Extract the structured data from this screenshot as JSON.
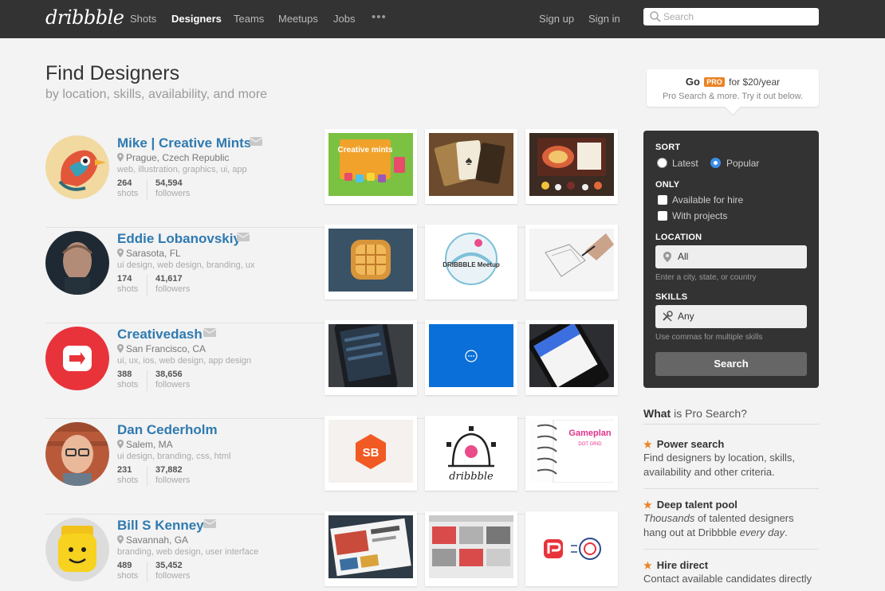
{
  "nav": {
    "logo": "dribbble",
    "links": [
      "Shots",
      "Designers",
      "Teams",
      "Meetups",
      "Jobs"
    ],
    "more": "•••",
    "signup": "Sign up",
    "signin": "Sign in",
    "search_placeholder": "Search"
  },
  "header": {
    "title": "Find Designers",
    "subtitle": "by location, skills, availability, and more"
  },
  "designers": [
    {
      "name": "Mike | Creative Mints",
      "location": "Prague, Czech Republic",
      "skills": "web, illustration, graphics, ui, app",
      "shots": "264",
      "followers": "54,594"
    },
    {
      "name": "Eddie Lobanovskiy",
      "location": "Sarasota, FL",
      "skills": "ui design, web design, branding, ux",
      "shots": "174",
      "followers": "41,617"
    },
    {
      "name": "Creativedash",
      "location": "San Francisco, CA",
      "skills": "ui, ux, ios, web design, app design",
      "shots": "388",
      "followers": "38,656"
    },
    {
      "name": "Dan Cederholm",
      "location": "Salem, MA",
      "skills": "ui design, branding, css, html",
      "shots": "231",
      "followers": "37,882"
    },
    {
      "name": "Bill S Kenney",
      "location": "Savannah, GA",
      "skills": "branding, web design, user interface",
      "shots": "489",
      "followers": "35,452"
    }
  ],
  "stat_labels": {
    "shots": "shots",
    "followers": "followers"
  },
  "shot_text": {
    "creative_mints": "Creative mints",
    "meetup": "DRIBBBLE Meetup",
    "sb": "SB",
    "gameplan": "Gameplan",
    "dot_grid": "DOT GRID"
  },
  "pro": {
    "go": "Go",
    "badge": "PRO",
    "price": "for $20/year",
    "tagline": "Pro Search & more. Try it out below."
  },
  "panel": {
    "sort_label": "SORT",
    "sort_options": [
      "Latest",
      "Popular"
    ],
    "sort_selected": "Popular",
    "only_label": "ONLY",
    "only_options": [
      "Available for hire",
      "With projects"
    ],
    "location_label": "LOCATION",
    "location_value": "All",
    "location_hint": "Enter a city, state, or country",
    "skills_label": "SKILLS",
    "skills_value": "Any",
    "skills_hint": "Use commas for multiple skills",
    "search_button": "Search"
  },
  "about": {
    "what": "What",
    "rest": "is Pro Search?",
    "features": [
      {
        "title": "Power search",
        "desc": "Find designers by location, skills, availability and other criteria."
      },
      {
        "title": "Deep talent pool",
        "desc_em1": "Thousands",
        "desc_mid": " of talented designers hang out at Dribbble ",
        "desc_em2": "every day",
        "desc_end": "."
      },
      {
        "title": "Hire direct",
        "desc": "Contact available candidates directly"
      }
    ]
  },
  "colors": {
    "nav_bg": "#333333",
    "link_blue": "#2f7ab0",
    "pro_orange": "#ea8324",
    "radio_blue": "#3b8ee8"
  }
}
